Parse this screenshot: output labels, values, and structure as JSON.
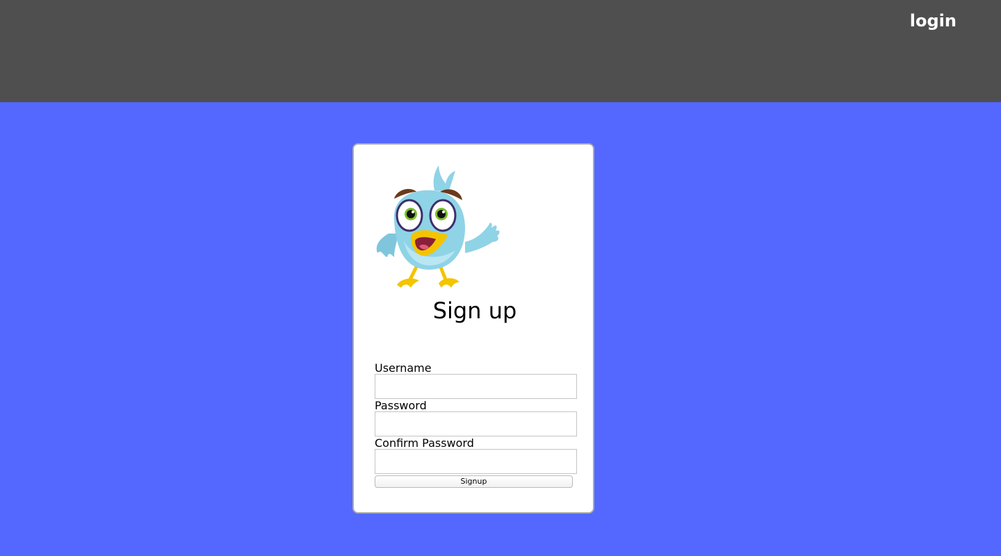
{
  "nav": {
    "login_label": "login"
  },
  "signup_form": {
    "title": "Sign up",
    "username": {
      "label": "Username",
      "value": ""
    },
    "password": {
      "label": "Password",
      "value": ""
    },
    "confirm_password": {
      "label": "Confirm Password",
      "value": ""
    },
    "submit_label": "Signup"
  },
  "icons": {
    "mascot": "cartoon-bird-mascot"
  },
  "colors": {
    "header_bg": "#4f4f4f",
    "page_bg": "#5468ff",
    "card_bg": "#ffffff",
    "nav_text": "#ffffff"
  }
}
